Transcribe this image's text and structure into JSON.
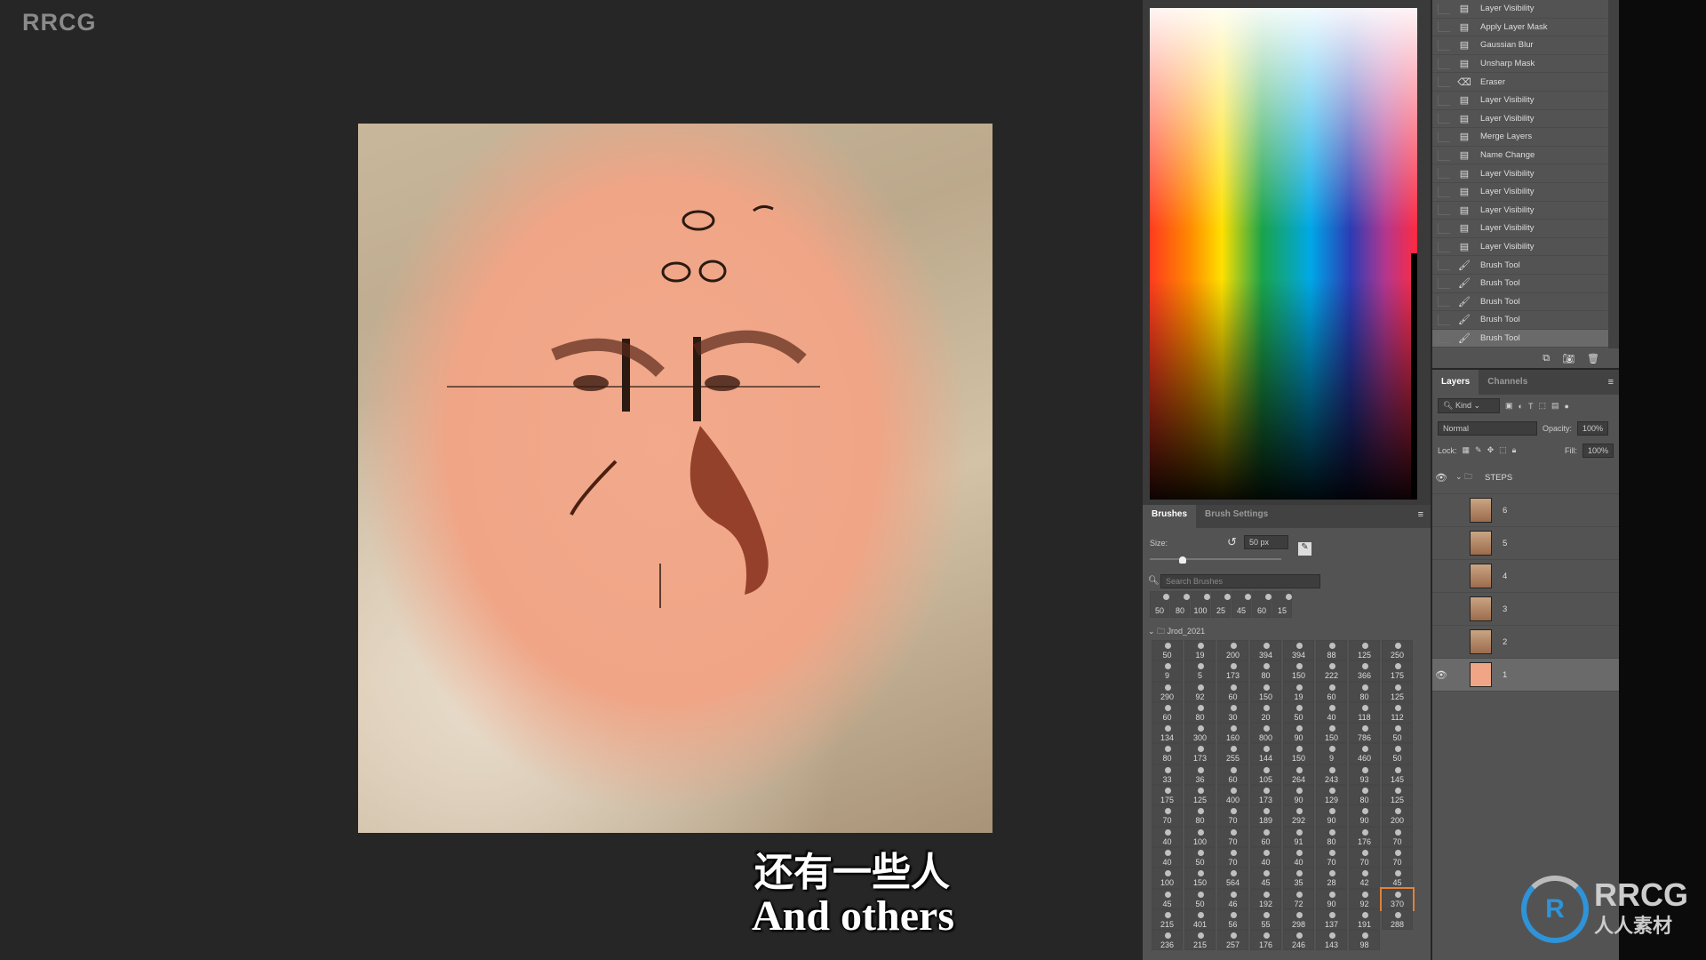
{
  "watermark": "RRCG",
  "subtitle": {
    "zh": "还有一些人",
    "en": "And others"
  },
  "logo": {
    "text": "RRCG",
    "subtext": "人人素材"
  },
  "brushes": {
    "tabs": [
      "Brushes",
      "Brush Settings"
    ],
    "size_label": "Size:",
    "size_value": "50 px",
    "size_fraction": 0.25,
    "search_placeholder": "Search Brushes",
    "recent": [
      "50",
      "80",
      "100",
      "25",
      "45",
      "60",
      "15"
    ],
    "folder": "Jrod_2021",
    "grid": [
      "50",
      "19",
      "200",
      "394",
      "394",
      "88",
      "125",
      "250",
      "9",
      "5",
      "173",
      "80",
      "150",
      "222",
      "366",
      "175",
      "290",
      "92",
      "60",
      "150",
      "19",
      "60",
      "80",
      "125",
      "60",
      "80",
      "30",
      "20",
      "50",
      "40",
      "118",
      "112",
      "134",
      "300",
      "160",
      "800",
      "90",
      "150",
      "786",
      "50",
      "80",
      "173",
      "255",
      "144",
      "150",
      "9",
      "460",
      "50",
      "33",
      "36",
      "60",
      "105",
      "264",
      "243",
      "93",
      "145",
      "175",
      "125",
      "400",
      "173",
      "90",
      "129",
      "80",
      "125",
      "70",
      "80",
      "70",
      "189",
      "292",
      "90",
      "90",
      "200",
      "40",
      "100",
      "70",
      "60",
      "91",
      "80",
      "176",
      "70",
      "40",
      "50",
      "70",
      "40",
      "40",
      "70",
      "70",
      "70",
      "100",
      "150",
      "564",
      "45",
      "35",
      "28",
      "42",
      "45",
      "45",
      "50",
      "46",
      "192",
      "72",
      "90",
      "92",
      "370",
      "215",
      "401",
      "56",
      "55",
      "298",
      "137",
      "191",
      "288",
      "236",
      "215",
      "257",
      "176",
      "246",
      "143",
      "98"
    ],
    "selected_index": 103
  },
  "history": {
    "items": [
      {
        "label": "Layer Visibility",
        "icon": "document-icon"
      },
      {
        "label": "Apply Layer Mask",
        "icon": "document-icon"
      },
      {
        "label": "Gaussian Blur",
        "icon": "document-icon"
      },
      {
        "label": "Unsharp Mask",
        "icon": "document-icon"
      },
      {
        "label": "Eraser",
        "icon": "eraser-icon"
      },
      {
        "label": "Layer Visibility",
        "icon": "document-icon"
      },
      {
        "label": "Layer Visibility",
        "icon": "document-icon"
      },
      {
        "label": "Merge Layers",
        "icon": "document-icon"
      },
      {
        "label": "Name Change",
        "icon": "document-icon"
      },
      {
        "label": "Layer Visibility",
        "icon": "document-icon"
      },
      {
        "label": "Layer Visibility",
        "icon": "document-icon"
      },
      {
        "label": "Layer Visibility",
        "icon": "document-icon"
      },
      {
        "label": "Layer Visibility",
        "icon": "document-icon"
      },
      {
        "label": "Layer Visibility",
        "icon": "document-icon"
      },
      {
        "label": "Brush Tool",
        "icon": "brush-icon"
      },
      {
        "label": "Brush Tool",
        "icon": "brush-icon"
      },
      {
        "label": "Brush Tool",
        "icon": "brush-icon"
      },
      {
        "label": "Brush Tool",
        "icon": "brush-icon"
      },
      {
        "label": "Brush Tool",
        "icon": "brush-icon",
        "active": true
      }
    ]
  },
  "layers": {
    "tabs": [
      "Layers",
      "Channels"
    ],
    "filter": "Kind",
    "blend_mode": "Normal",
    "opacity_label": "Opacity:",
    "opacity": "100%",
    "lock_label": "Lock:",
    "fill_label": "Fill:",
    "fill": "100%",
    "group": "STEPS",
    "items": [
      {
        "name": "6",
        "visible": false
      },
      {
        "name": "5",
        "visible": false
      },
      {
        "name": "4",
        "visible": false
      },
      {
        "name": "3",
        "visible": false
      },
      {
        "name": "2",
        "visible": false
      },
      {
        "name": "1",
        "visible": true,
        "active": true
      }
    ]
  },
  "colors": {
    "accent": "#e0823a",
    "skin": "#f0a586",
    "panel": "#535353"
  }
}
